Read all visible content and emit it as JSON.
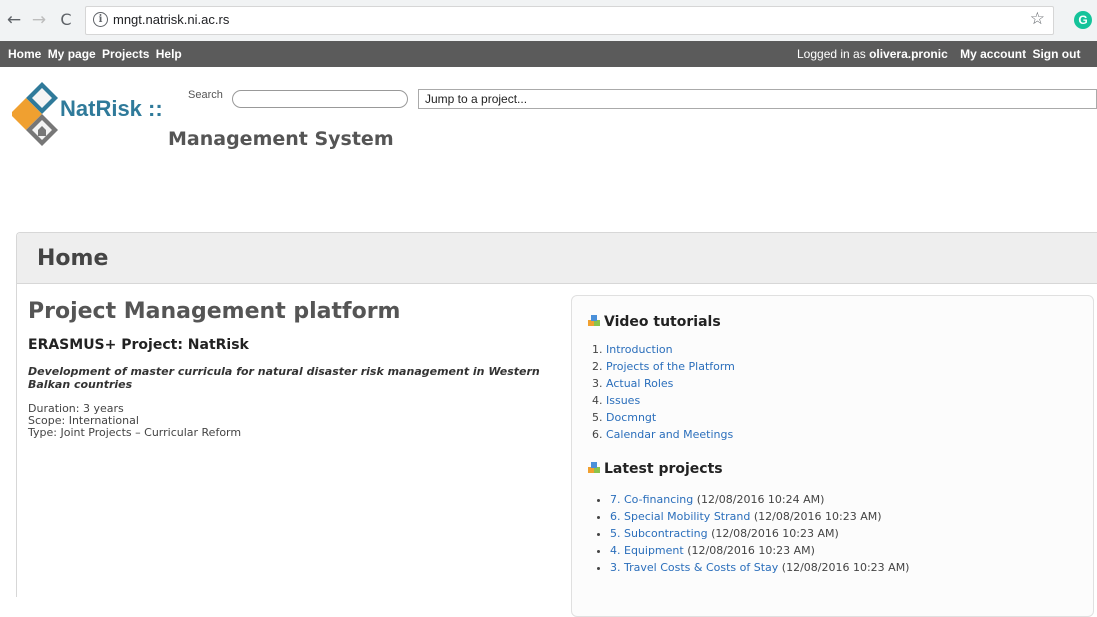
{
  "browser": {
    "url": "mngt.natrisk.ni.ac.rs",
    "back_glyph": "←",
    "forward_glyph": "→",
    "reload_glyph": "C",
    "info_glyph": "i",
    "star_glyph": "☆",
    "extension_glyph": "G"
  },
  "top_menu": {
    "left_items": [
      "Home",
      "My page",
      "Projects",
      "Help"
    ],
    "logged_in_prefix": "Logged in as ",
    "username": "olivera.pronic",
    "right_items": [
      "My account",
      "Sign out"
    ]
  },
  "header": {
    "logo_text": "NatRisk",
    "logo_separator": " ::",
    "subtitle": "Management System",
    "search_label": "Search",
    "search_value": "",
    "jump_to_project": "Jump to a project..."
  },
  "page": {
    "title": "Home"
  },
  "platform": {
    "title": "Project Management platform",
    "project": "ERASMUS+ Project: NatRisk",
    "description": "Development of master curricula for natural disaster risk management in Western Balkan countries",
    "duration": "Duration: 3 years",
    "scope": "Scope: International",
    "type": "Type: Joint Projects – Curricular Reform"
  },
  "video_tutorials": {
    "title": "Video tutorials",
    "items": [
      {
        "num": "1.",
        "label": "Introduction"
      },
      {
        "num": "2.",
        "label": "Projects of the Platform"
      },
      {
        "num": "3.",
        "label": "Actual Roles"
      },
      {
        "num": "4.",
        "label": "Issues"
      },
      {
        "num": "5.",
        "label": "Docmngt"
      },
      {
        "num": "6.",
        "label": "Calendar and Meetings"
      }
    ]
  },
  "latest_projects": {
    "title": "Latest projects",
    "items": [
      {
        "label": "7. Co-financing",
        "date": " (12/08/2016 10:24 AM)"
      },
      {
        "label": "6. Special Mobility Strand",
        "date": " (12/08/2016 10:23 AM)"
      },
      {
        "label": "5. Subcontracting",
        "date": " (12/08/2016 10:23 AM)"
      },
      {
        "label": "4. Equipment",
        "date": " (12/08/2016 10:23 AM)"
      },
      {
        "label": "3. Travel Costs & Costs of Stay",
        "date": " (12/08/2016 10:23 AM)"
      }
    ]
  },
  "colors": {
    "menu_bar": "#5b5b5b",
    "link": "#2a6ebb",
    "logo_blue": "#2f7a9a",
    "logo_orange": "#f0a030",
    "header_band": "#eeeeee"
  }
}
